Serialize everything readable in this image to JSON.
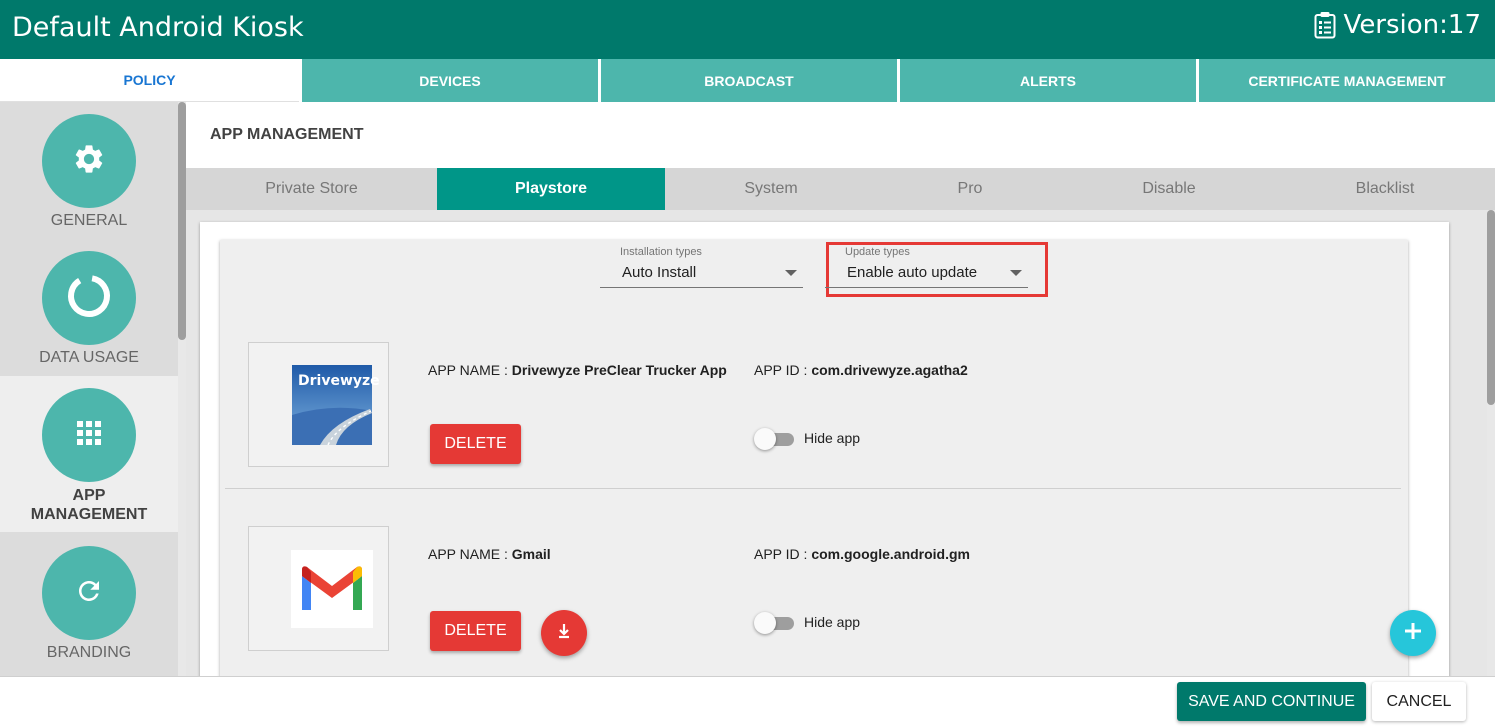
{
  "header": {
    "title": "Default Android Kiosk",
    "version": "Version:17"
  },
  "tabs": [
    {
      "label": "POLICY",
      "active": true
    },
    {
      "label": "DEVICES",
      "active": false
    },
    {
      "label": "BROADCAST",
      "active": false
    },
    {
      "label": "ALERTS",
      "active": false
    },
    {
      "label": "CERTIFICATE MANAGEMENT",
      "active": false
    }
  ],
  "sidebar": {
    "items": [
      {
        "label": "GENERAL",
        "icon": "gear-icon"
      },
      {
        "label": "DATA USAGE",
        "icon": "pie-ring-icon"
      },
      {
        "label": "APP MANAGEMENT",
        "icon": "grid-icon",
        "active": true
      },
      {
        "label": "BRANDING",
        "icon": "refresh-icon"
      }
    ]
  },
  "main": {
    "title": "APP MANAGEMENT",
    "subtabs": [
      {
        "label": "Private Store",
        "active": false
      },
      {
        "label": "Playstore",
        "active": true
      },
      {
        "label": "System",
        "active": false
      },
      {
        "label": "Pro",
        "active": false
      },
      {
        "label": "Disable",
        "active": false
      },
      {
        "label": "Blacklist",
        "active": false
      }
    ],
    "installation_select": {
      "label": "Installation types",
      "value": "Auto Install"
    },
    "update_select": {
      "label": "Update types",
      "value": "Enable auto update"
    },
    "apps": [
      {
        "name_prefix": "APP NAME : ",
        "name": "Drivewyze PreClear Trucker App",
        "id_prefix": "APP ID : ",
        "id": "com.drivewyze.agatha2",
        "logo_text": "Drivewyze",
        "delete_label": "DELETE",
        "hide_label": "Hide app",
        "hidden": false
      },
      {
        "name_prefix": "APP NAME : ",
        "name": "Gmail",
        "id_prefix": "APP ID : ",
        "id": "com.google.android.gm",
        "delete_label": "DELETE",
        "hide_label": "Hide app",
        "hidden": false
      }
    ]
  },
  "footer": {
    "save_label": "SAVE AND CONTINUE",
    "cancel_label": "CANCEL"
  },
  "colors": {
    "primary": "#00796b",
    "tab": "#4db6ac",
    "active_subtab": "#009688",
    "danger": "#e53935",
    "fab": "#26c6da",
    "highlight": "#e53935"
  }
}
